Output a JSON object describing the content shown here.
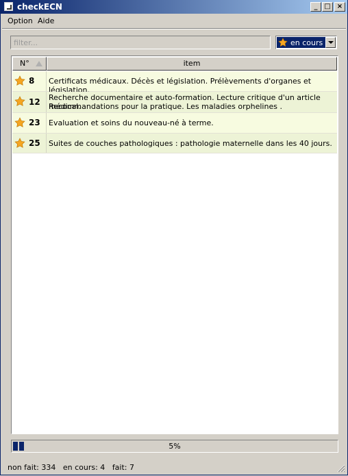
{
  "window": {
    "title": "checkECN"
  },
  "titlebar_buttons": {
    "minimize": "_",
    "maximize": "□",
    "close": "×"
  },
  "menu": [
    "Option",
    "Aide"
  ],
  "filter": {
    "placeholder": "filter...",
    "value": ""
  },
  "status_filter": {
    "selected": "en cours",
    "icon": "star-icon"
  },
  "table": {
    "columns": [
      "N°",
      "item"
    ],
    "rows": [
      {
        "icon": "star-icon",
        "num": "8",
        "text": "Certificats médicaux. Décès et législation. Prélèvements d'organes et législation."
      },
      {
        "icon": "star-icon",
        "num": "12",
        "text_line1": "Recherche documentaire et auto-formation. Lecture critique d'un article médical.",
        "text_line2": "Recommandations pour la pratique. Les maladies orphelines ."
      },
      {
        "icon": "star-icon",
        "num": "23",
        "text": "Evaluation et soins du nouveau-né à terme."
      },
      {
        "icon": "star-icon",
        "num": "25",
        "text": "Suites de couches pathologiques : pathologie maternelle dans les 40 jours."
      }
    ]
  },
  "progress": {
    "label": "5%",
    "value": 0.05
  },
  "status_bar": {
    "non_fait": "non fait: 334",
    "en_cours": "en cours: 4",
    "fait": "fait: 7"
  },
  "colors": {
    "title_start": "#0a246a",
    "title_end": "#a6caf0",
    "selection": "#0a246a",
    "row_odd": "#f7fbe0",
    "row_even": "#edf3d6",
    "star": "#f5a623"
  }
}
